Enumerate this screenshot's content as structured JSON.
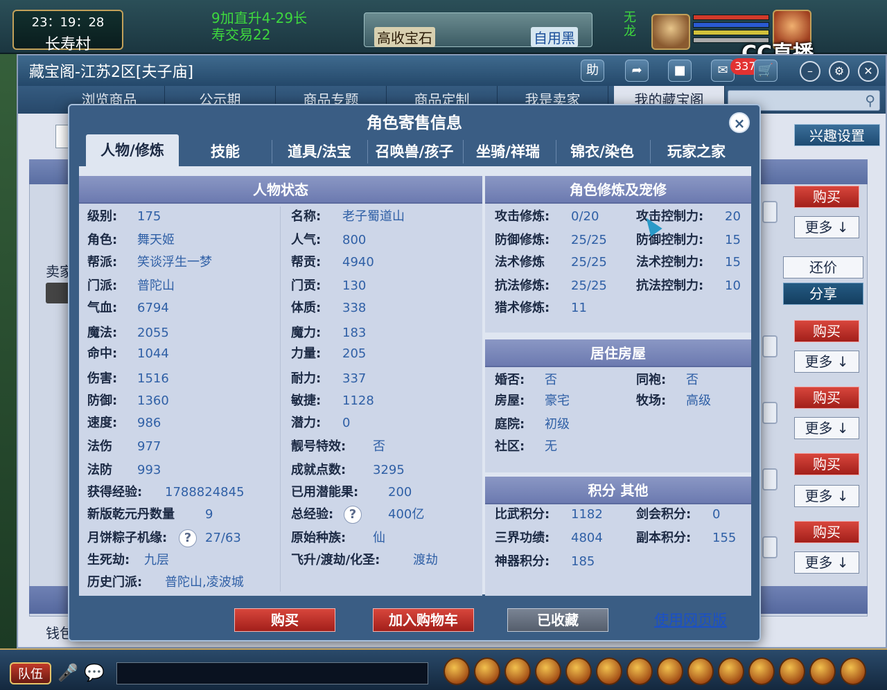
{
  "game_hud": {
    "time": "23：19：28",
    "location": "长寿村",
    "chat_line1": "9加直升4-29长",
    "chat_line2": "寿交易22",
    "banner_a": "高收宝石",
    "banner_b": "自用黑",
    "banner_c": "",
    "green_text_1": "无",
    "green_text_2": "龙",
    "stream_logo": "CC直播"
  },
  "store": {
    "title": "藏宝阁-江苏2区[夫子庙]",
    "toolbar": {
      "help": "助",
      "cart_count": "337"
    },
    "nav": [
      "浏览商品",
      "公示期",
      "商品专题",
      "商品定制",
      "我是卖家",
      "我的藏宝阁"
    ],
    "nav_active": "我的藏宝阁",
    "interest_settings": "兴趣设置",
    "seller_label": "卖家",
    "money_label": "钱包",
    "buy": "购买",
    "more": "更多",
    "bargain": "还价",
    "share": "分享"
  },
  "modal": {
    "title": "角色寄售信息",
    "close": "×",
    "tabs": [
      "人物/修炼",
      "技能",
      "道具/法宝",
      "召唤兽/孩子",
      "坐骑/祥瑞",
      "锦衣/染色",
      "玩家之家"
    ],
    "active_tab": "人物/修炼",
    "status_panel": {
      "title": "人物状态",
      "left": [
        {
          "label": "级别:",
          "value": "175"
        },
        {
          "label": "角色:",
          "value": "舞天姬"
        },
        {
          "label": "帮派:",
          "value": "笑谈浮生一梦"
        },
        {
          "label": "门派:",
          "value": "普陀山"
        },
        {
          "label": "气血:",
          "value": "6794"
        },
        {
          "label": "魔法:",
          "value": "2055"
        },
        {
          "label": "命中:",
          "value": "1044"
        },
        {
          "label": "伤害:",
          "value": "1516"
        },
        {
          "label": "防御:",
          "value": "1360"
        },
        {
          "label": "速度:",
          "value": "986"
        },
        {
          "label": "法伤",
          "value": "977"
        },
        {
          "label": "法防",
          "value": "993"
        },
        {
          "label": "获得经验:",
          "value": "1788824845"
        },
        {
          "label": "新版乾元丹数量",
          "value": "9"
        },
        {
          "label": "月饼粽子机缘:",
          "value": "27/63"
        },
        {
          "label": "生死劫:",
          "value": "九层"
        },
        {
          "label": "历史门派:",
          "value": "普陀山,凌波城"
        }
      ],
      "right": [
        {
          "label": "名称:",
          "value": "老子蜀道山"
        },
        {
          "label": "人气:",
          "value": "800"
        },
        {
          "label": "帮贡:",
          "value": "4940"
        },
        {
          "label": "门贡:",
          "value": "130"
        },
        {
          "label": "体质:",
          "value": "338"
        },
        {
          "label": "魔力:",
          "value": "183"
        },
        {
          "label": "力量:",
          "value": "205"
        },
        {
          "label": "耐力:",
          "value": "337"
        },
        {
          "label": "敏捷:",
          "value": "1128"
        },
        {
          "label": "潜力:",
          "value": "0"
        },
        {
          "label": "靓号特效:",
          "value": "否"
        },
        {
          "label": "成就点数:",
          "value": "3295"
        },
        {
          "label": "已用潜能果:",
          "value": "200"
        },
        {
          "label": "总经验:",
          "value": "400亿"
        },
        {
          "label": "原始种族:",
          "value": "仙"
        },
        {
          "label": "飞升/渡劫/化圣:",
          "value": "渡劫"
        }
      ]
    },
    "cultivation_panel": {
      "title": "角色修炼及宠修",
      "rows": [
        {
          "l1": "攻击修炼:",
          "v1": "0/20",
          "l2": "攻击控制力:",
          "v2": "20"
        },
        {
          "l1": "防御修炼:",
          "v1": "25/25",
          "l2": "防御控制力:",
          "v2": "15"
        },
        {
          "l1": "法术修炼",
          "v1": "25/25",
          "l2": "法术控制力:",
          "v2": "15"
        },
        {
          "l1": "抗法修炼:",
          "v1": "25/25",
          "l2": "抗法控制力:",
          "v2": "10"
        },
        {
          "l1": "猎术修炼:",
          "v1": "11",
          "l2": "",
          "v2": ""
        }
      ]
    },
    "house_panel": {
      "title": "居住房屋",
      "rows": [
        {
          "l1": "婚否:",
          "v1": "否",
          "l2": "同袍:",
          "v2": "否"
        },
        {
          "l1": "房屋:",
          "v1": "豪宅",
          "l2": "牧场:",
          "v2": "高级"
        },
        {
          "l1": "庭院:",
          "v1": "初级",
          "l2": "",
          "v2": ""
        },
        {
          "l1": "社区:",
          "v1": "无",
          "l2": "",
          "v2": ""
        }
      ]
    },
    "points_panel": {
      "title": "积分 其他",
      "rows": [
        {
          "l1": "比武积分:",
          "v1": "1182",
          "l2": "剑会积分:",
          "v2": "0"
        },
        {
          "l1": "三界功绩:",
          "v1": "4804",
          "l2": "副本积分:",
          "v2": "155"
        },
        {
          "l1": "神器积分:",
          "v1": "185",
          "l2": "",
          "v2": ""
        }
      ]
    },
    "footer": {
      "buy": "购买",
      "add_cart": "加入购物车",
      "favorited": "已收藏",
      "web_version": "使用网页版"
    }
  },
  "bottom_bar": {
    "team": "队伍"
  },
  "colors": {
    "modal_bg": "#3a5d84",
    "panel_head": "#7b88bb",
    "value_blue": "#3060a6",
    "buy_red": "#c0302a"
  }
}
